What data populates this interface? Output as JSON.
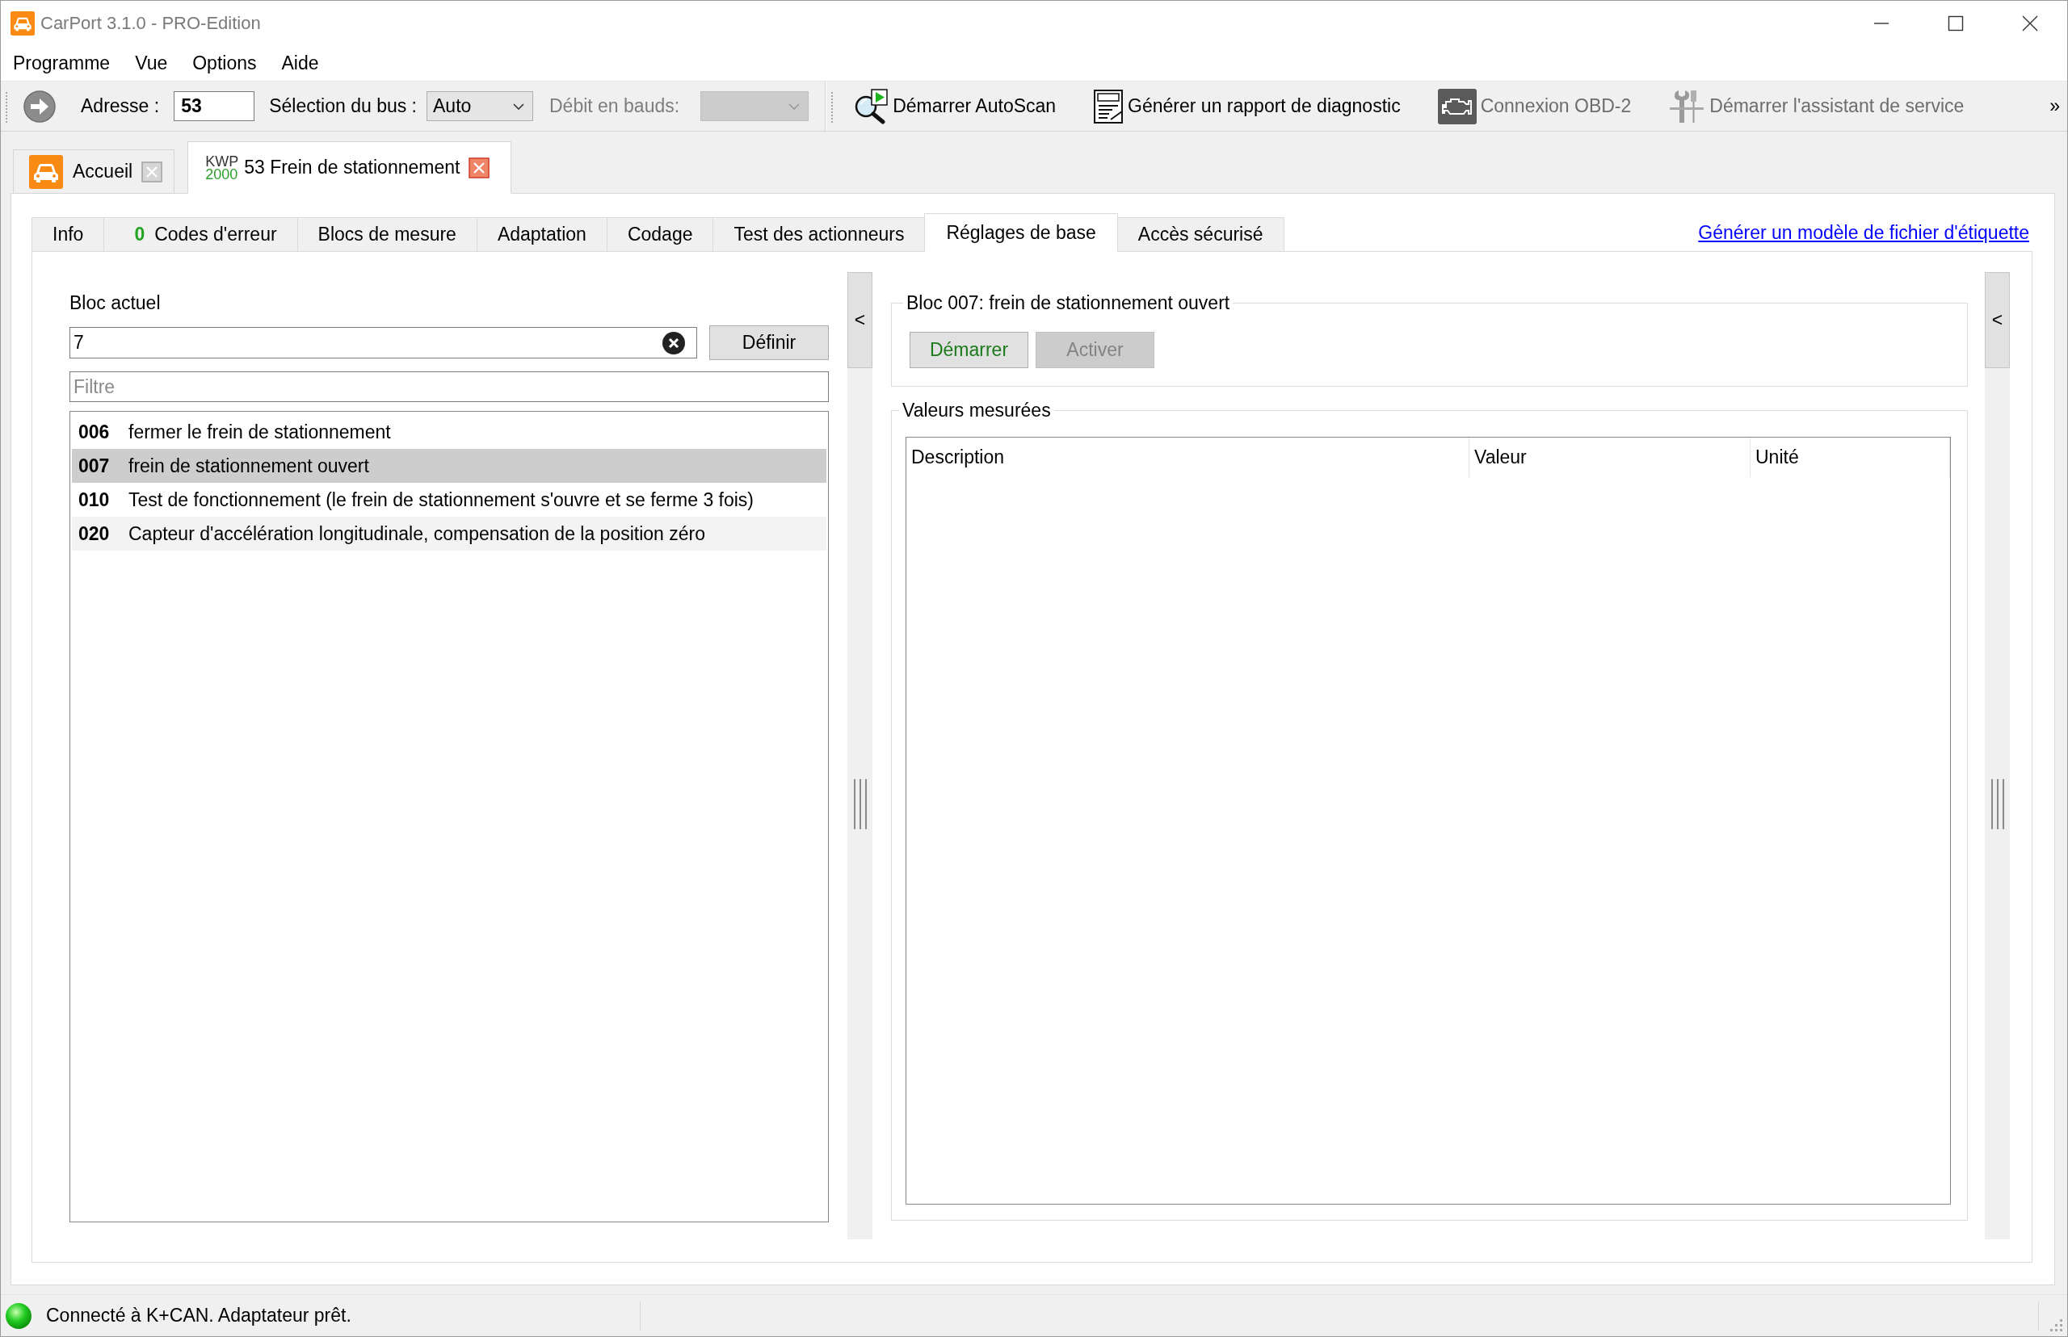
{
  "window": {
    "title": "CarPort 3.1.0 - PRO-Edition"
  },
  "menu": [
    "Programme",
    "Vue",
    "Options",
    "Aide"
  ],
  "toolbar": {
    "address": {
      "label": "Adresse :",
      "value": "53"
    },
    "bus": {
      "label": "Sélection du bus :",
      "value": "Auto"
    },
    "baud": {
      "label": "Débit en bauds:",
      "disabled": true
    },
    "actions": [
      {
        "kind": "autoscan",
        "label": "Démarrer AutoScan",
        "disabled": false
      },
      {
        "kind": "report",
        "label": "Générer un rapport de diagnostic",
        "disabled": false
      },
      {
        "kind": "obd",
        "label": "Connexion OBD-2",
        "disabled": true
      },
      {
        "kind": "service",
        "label": "Démarrer l'assistant de service",
        "disabled": true
      }
    ],
    "overflow": "»"
  },
  "documents": [
    {
      "kind": "home",
      "label": "Accueil",
      "selected": false
    },
    {
      "kind": "module",
      "protocol": "KWP",
      "protocol_version": "2000",
      "label": "53 Frein de stationnement",
      "selected": true
    }
  ],
  "tabs": [
    {
      "label": "Info",
      "selected": false
    },
    {
      "label": "Codes d'erreur",
      "count": "0",
      "selected": false
    },
    {
      "label": "Blocs de mesure",
      "selected": false
    },
    {
      "label": "Adaptation",
      "selected": false
    },
    {
      "label": "Codage",
      "selected": false
    },
    {
      "label": "Test des actionneurs",
      "selected": false
    },
    {
      "label": "Réglages de base",
      "selected": true
    },
    {
      "label": "Accès sécurisé",
      "selected": false
    }
  ],
  "template_link": "Générer un modèle de fichier d'étiquette",
  "current_block": {
    "label": "Bloc actuel",
    "value": "7",
    "button": "Définir",
    "filter_placeholder": "Filtre"
  },
  "blocks": [
    {
      "number": "006",
      "text": "fermer le frein de stationnement",
      "selected": false
    },
    {
      "number": "007",
      "text": "frein de stationnement ouvert",
      "selected": true
    },
    {
      "number": "010",
      "text": "Test de fonctionnement (le frein de stationnement s'ouvre et se ferme 3 fois)",
      "selected": false
    },
    {
      "number": "020",
      "text": "Capteur d'accélération longitudinale, compensation de la position zéro",
      "selected": false
    }
  ],
  "splitters": [
    {
      "toggle": "<"
    },
    {
      "toggle": "<"
    }
  ],
  "block_group": {
    "title": "Bloc 007: frein de stationnement ouvert",
    "buttons": [
      {
        "kind": "start",
        "label": "Démarrer",
        "disabled": false
      },
      {
        "kind": "activate",
        "label": "Activer",
        "disabled": true
      }
    ]
  },
  "measured_values": {
    "title": "Valeurs mesurées",
    "columns": [
      "Description",
      "Valeur",
      "Unité"
    ]
  },
  "status_bar": {
    "connected": true,
    "text": "Connecté à K+CAN. Adaptateur prêt."
  }
}
